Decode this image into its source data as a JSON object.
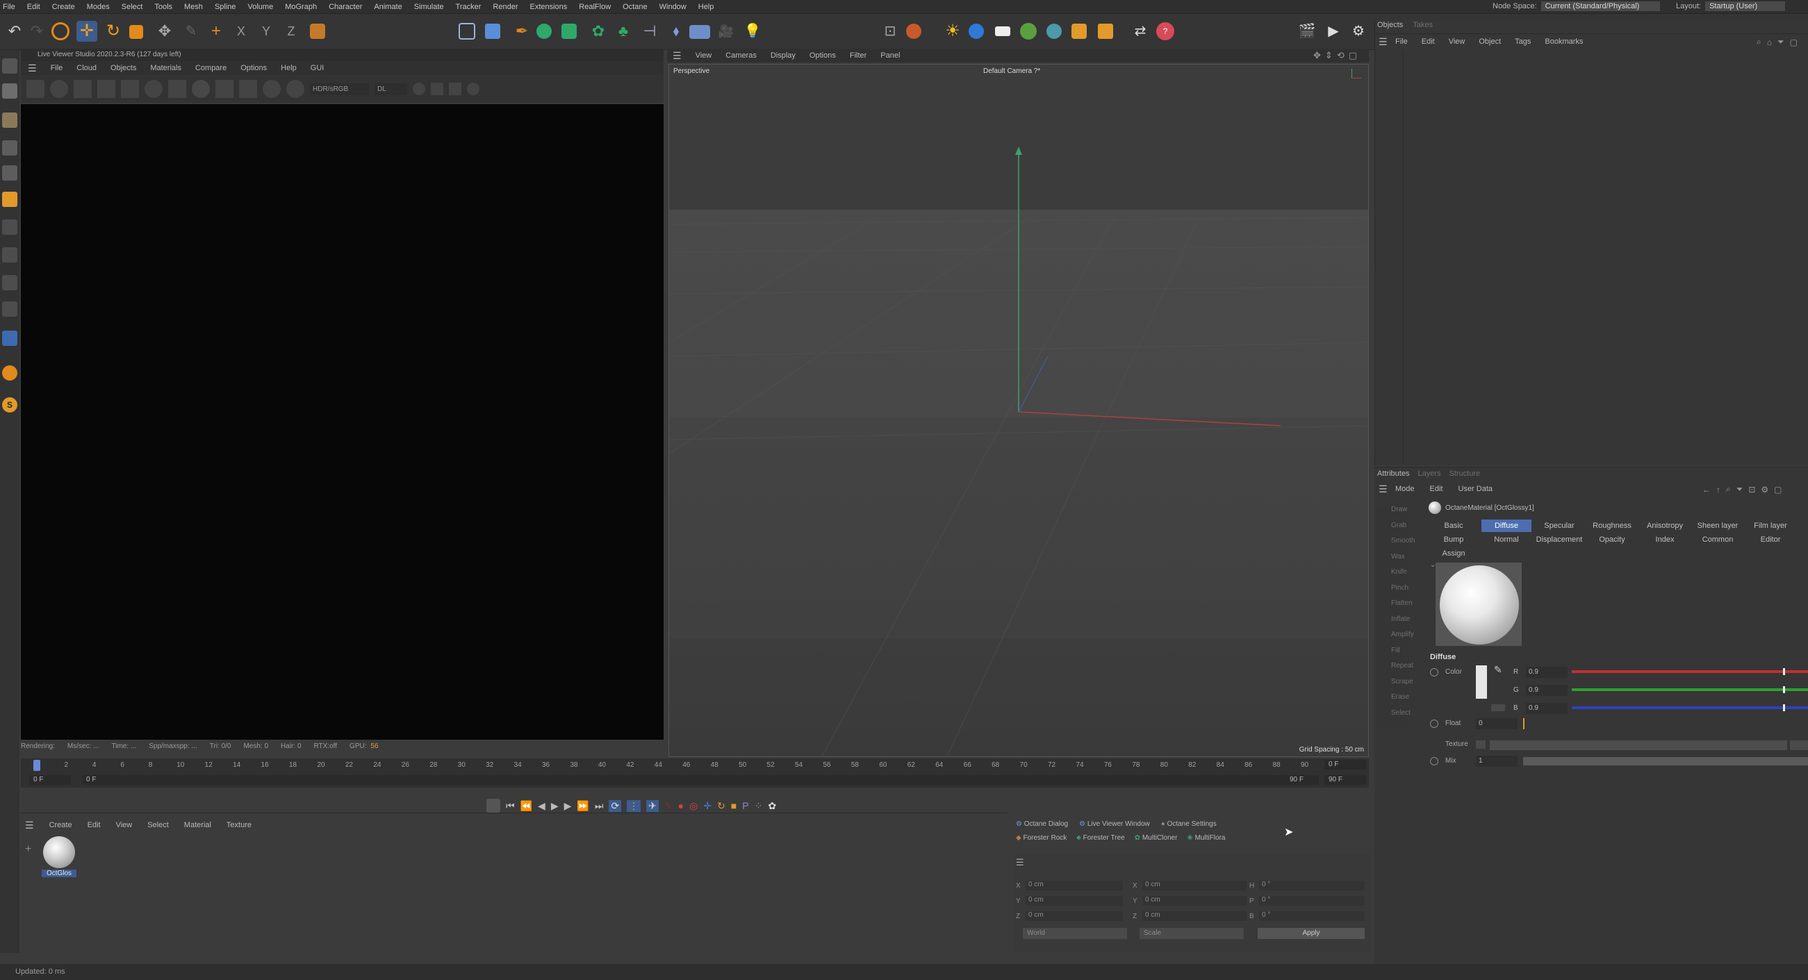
{
  "menubar": {
    "items": [
      "File",
      "Edit",
      "Create",
      "Modes",
      "Select",
      "Tools",
      "Mesh",
      "Spline",
      "Volume",
      "MoGraph",
      "Character",
      "Animate",
      "Simulate",
      "Tracker",
      "Render",
      "Extensions",
      "RealFlow",
      "Octane",
      "Window",
      "Help"
    ],
    "node_space_label": "Node Space:",
    "node_space_value": "Current (Standard/Physical)",
    "layout_label": "Layout:",
    "layout_value": "Startup (User)"
  },
  "live_viewer": {
    "title": "Live Viewer Studio 2020.2.3-R6 (127 days left)",
    "menu": [
      "File",
      "Cloud",
      "Objects",
      "Materials",
      "Compare",
      "Options",
      "Help",
      "GUI"
    ],
    "mode_select": "HDR/sRGB",
    "kernel_select": "DL",
    "status": [
      "Rendering:",
      "Ms/sec: ...",
      "Time: ...",
      "Spp/maxspp: ...",
      "Tri: 0/0",
      "Mesh: 0",
      "Hair: 0",
      "RTX:off",
      "GPU:",
      "56"
    ]
  },
  "viewport": {
    "menu": [
      "View",
      "Cameras",
      "Display",
      "Options",
      "Filter",
      "Panel"
    ],
    "label_left": "Perspective",
    "label_center": "Default Camera ?*",
    "grid_spacing": "Grid Spacing : 50 cm"
  },
  "objects_panel": {
    "tabs": [
      "Objects",
      "Takes"
    ],
    "menu": [
      "File",
      "Edit",
      "View",
      "Object",
      "Tags",
      "Bookmarks"
    ]
  },
  "attributes": {
    "tabs": [
      "Attributes",
      "Layers",
      "Structure"
    ],
    "menu": [
      "Mode",
      "Edit",
      "User Data"
    ],
    "material_name": "OctaneMaterial [OctGlossy1]",
    "tabs_row1": [
      "Basic",
      "Diffuse",
      "Specular",
      "Roughness",
      "Anisotropy",
      "Sheen layer",
      "Film layer"
    ],
    "tabs_row2": [
      "Bump",
      "Normal",
      "Displacement",
      "Opacity",
      "Index",
      "Common",
      "Editor"
    ],
    "tab_assign": "Assign",
    "active_tab": "Diffuse",
    "section": "Diffuse",
    "color_label": "Color",
    "r_label": "R",
    "r_value": "0.9",
    "g_label": "G",
    "g_value": "0.9",
    "b_label": "B",
    "b_value": "0.9",
    "float_label": "Float",
    "float_value": "0",
    "texture_label": "Texture",
    "mix_label": "Mix",
    "mix_value": "1",
    "colors": {
      "r": "#c03030",
      "g": "#2fa02f",
      "b": "#3040c0"
    }
  },
  "sculpt_tools": [
    "Draw",
    "Grab",
    "Smooth",
    "Wax",
    "Knife",
    "Pinch",
    "Flatten",
    "Inflate",
    "Amplify",
    "Fill",
    "Repeat",
    "Scrape",
    "Erase",
    "Select"
  ],
  "timeline": {
    "ticks": [
      "0",
      "2",
      "4",
      "6",
      "8",
      "10",
      "12",
      "14",
      "16",
      "18",
      "20",
      "22",
      "24",
      "26",
      "28",
      "30",
      "32",
      "34",
      "36",
      "38",
      "40",
      "42",
      "44",
      "46",
      "48",
      "50",
      "52",
      "54",
      "56",
      "58",
      "60",
      "62",
      "64",
      "66",
      "68",
      "70",
      "72",
      "74",
      "76",
      "78",
      "80",
      "82",
      "84",
      "86",
      "88",
      "90"
    ],
    "current_frame": "0 F",
    "start_frame": "0 F",
    "min_frame": "0 F",
    "end_frame": "90 F",
    "max_frame": "90 F"
  },
  "material_manager": {
    "menu": [
      "Create",
      "Edit",
      "View",
      "Select",
      "Material",
      "Texture"
    ],
    "material_label": "OctGlos"
  },
  "octane_bar": {
    "row1": [
      "Octane Dialog",
      "Live Viewer Window",
      "Octane Settings"
    ],
    "row2": [
      "Forester Rock",
      "Forester Tree",
      "MultiCloner",
      "MultiFlora"
    ]
  },
  "coords": {
    "x_pos": "0 cm",
    "y_pos": "0 cm",
    "z_pos": "0 cm",
    "x_size": "0 cm",
    "y_size": "0 cm",
    "z_size": "0 cm",
    "h_rot": "0 °",
    "p_rot": "0 °",
    "b_rot": "0 °",
    "space_select": "World",
    "scale_select": "Scale",
    "apply": "Apply"
  },
  "statusbar": {
    "text": "Updated: 0 ms"
  }
}
